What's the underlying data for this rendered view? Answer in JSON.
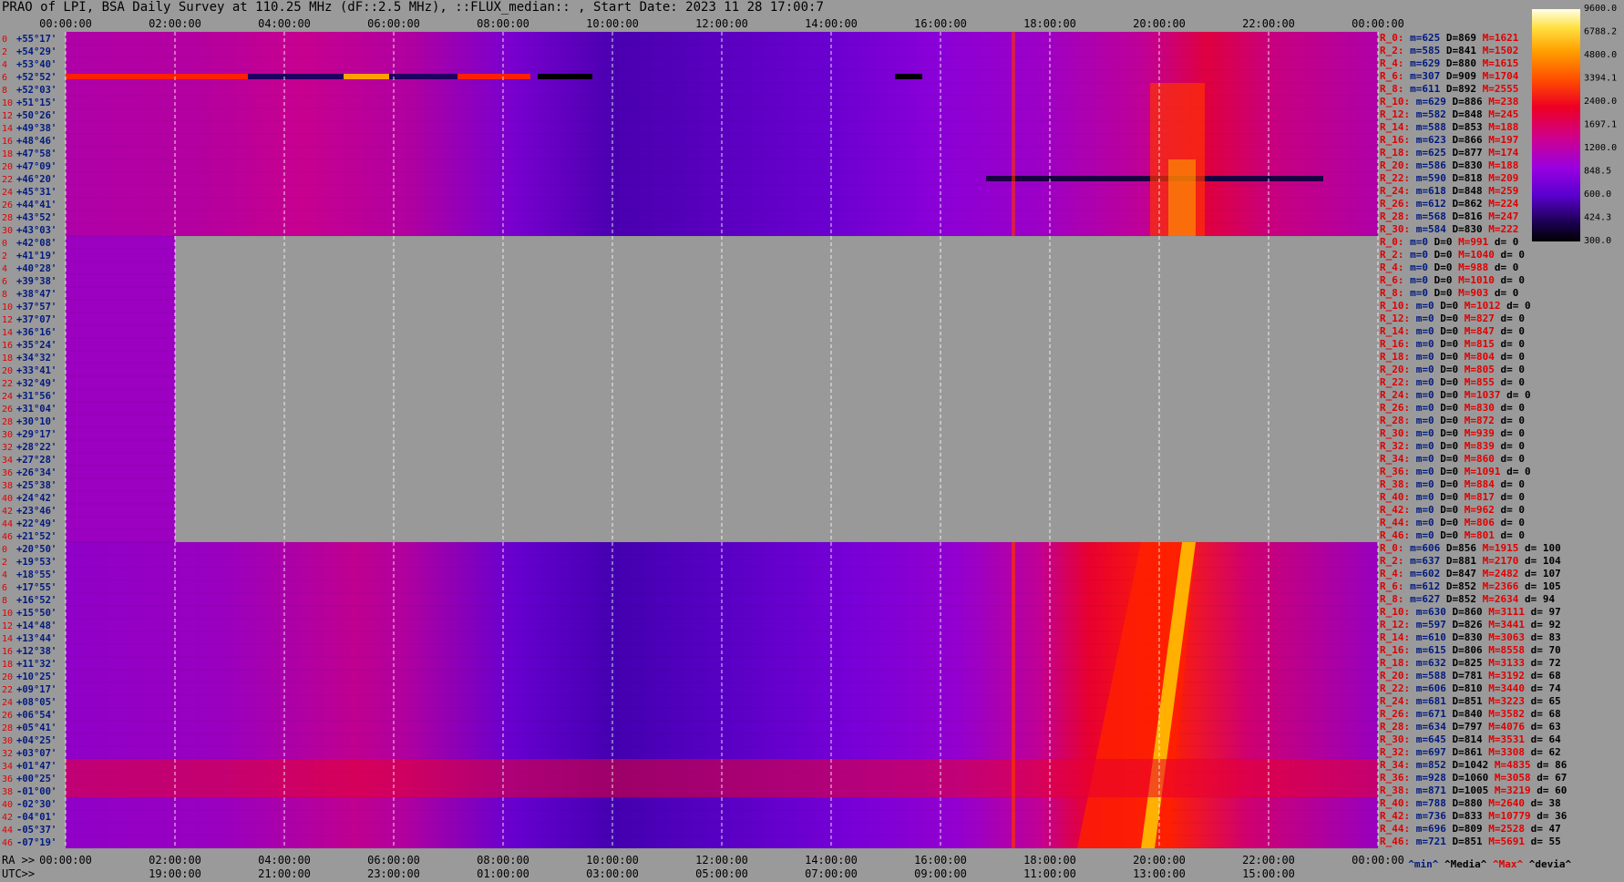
{
  "chart_data": {
    "type": "heatmap",
    "title": "PRAO of LPI, BSA Daily Survey at 110.25 MHz (dF::2.5 MHz), ::FLUX_median:: , Start Date: 2023 11 28 17:00:7",
    "x_top_ticks": [
      "00:00:00",
      "02:00:00",
      "04:00:00",
      "06:00:00",
      "08:00:00",
      "10:00:00",
      "12:00:00",
      "14:00:00",
      "16:00:00",
      "18:00:00",
      "20:00:00",
      "22:00:00",
      "00:00:00"
    ],
    "x_bottom_ticks_ra": [
      "00:00:00",
      "02:00:00",
      "04:00:00",
      "06:00:00",
      "08:00:00",
      "10:00:00",
      "12:00:00",
      "14:00:00",
      "16:00:00",
      "18:00:00",
      "20:00:00",
      "22:00:00",
      "00:00:00"
    ],
    "x_bottom_ticks_utc": [
      "",
      "19:00:00",
      "21:00:00",
      "23:00:00",
      "01:00:00",
      "03:00:00",
      "05:00:00",
      "07:00:00",
      "09:00:00",
      "11:00:00",
      "13:00:00",
      "15:00:00",
      ""
    ],
    "ra_label": "RA >>",
    "utc_label": "UTC>>",
    "colorbar_ticks": [
      "9600.0",
      "6788.2",
      "4800.0",
      "3394.1",
      "2400.0",
      "1697.1",
      "1200.0",
      "848.5",
      "600.0",
      "424.3",
      "300.0"
    ],
    "blocks": [
      {
        "index_labels": [
          "0",
          "2",
          "4",
          "6",
          "8",
          "10",
          "12",
          "14",
          "16",
          "18",
          "20",
          "22",
          "24",
          "26",
          "28",
          "30"
        ],
        "dec_labels": [
          "+55°17'",
          "+54°29'",
          "+53°40'",
          "+52°52'",
          "+52°03'",
          "+51°15'",
          "+50°26'",
          "+49°38'",
          "+48°46'",
          "+47°58'",
          "+47°09'",
          "+46°20'",
          "+45°31'",
          "+44°41'",
          "+43°52'",
          "+43°03'"
        ],
        "stats": [
          [
            "R_0:",
            "m=625",
            "D=869",
            "M=1621",
            ""
          ],
          [
            "R_2:",
            "m=585",
            "D=841",
            "M=1502",
            ""
          ],
          [
            "R_4:",
            "m=629",
            "D=880",
            "M=1615",
            ""
          ],
          [
            "R_6:",
            "m=307",
            "D=909",
            "M=1704",
            ""
          ],
          [
            "R_8:",
            "m=611",
            "D=892",
            "M=2555",
            ""
          ],
          [
            "R_10:",
            "m=629",
            "D=886",
            "M=238",
            ""
          ],
          [
            "R_12:",
            "m=582",
            "D=848",
            "M=245",
            ""
          ],
          [
            "R_14:",
            "m=588",
            "D=853",
            "M=188",
            ""
          ],
          [
            "R_16:",
            "m=623",
            "D=866",
            "M=197",
            ""
          ],
          [
            "R_18:",
            "m=625",
            "D=877",
            "M=174",
            ""
          ],
          [
            "R_20:",
            "m=586",
            "D=830",
            "M=188",
            ""
          ],
          [
            "R_22:",
            "m=590",
            "D=818",
            "M=209",
            ""
          ],
          [
            "R_24:",
            "m=618",
            "D=848",
            "M=259",
            ""
          ],
          [
            "R_26:",
            "m=612",
            "D=862",
            "M=224",
            ""
          ],
          [
            "R_28:",
            "m=568",
            "D=816",
            "M=247",
            ""
          ],
          [
            "R_30:",
            "m=584",
            "D=830",
            "M=222",
            ""
          ]
        ]
      },
      {
        "index_labels": [
          "0",
          "2",
          "4",
          "6",
          "8",
          "10",
          "12",
          "14",
          "16",
          "18",
          "20",
          "22",
          "24",
          "26",
          "28",
          "30",
          "32",
          "34",
          "36",
          "38",
          "40",
          "42",
          "44",
          "46"
        ],
        "dec_labels": [
          "+42°08'",
          "+41°19'",
          "+40°28'",
          "+39°38'",
          "+38°47'",
          "+37°57'",
          "+37°07'",
          "+36°16'",
          "+35°24'",
          "+34°32'",
          "+33°41'",
          "+32°49'",
          "+31°56'",
          "+31°04'",
          "+30°10'",
          "+29°17'",
          "+28°22'",
          "+27°28'",
          "+26°34'",
          "+25°38'",
          "+24°42'",
          "+23°46'",
          "+22°49'",
          "+21°52'"
        ],
        "stats": [
          [
            "R_0:",
            "m=0",
            "D=0",
            "M=991",
            "d= 0"
          ],
          [
            "R_2:",
            "m=0",
            "D=0",
            "M=1040",
            "d= 0"
          ],
          [
            "R_4:",
            "m=0",
            "D=0",
            "M=988",
            "d= 0"
          ],
          [
            "R_6:",
            "m=0",
            "D=0",
            "M=1010",
            "d= 0"
          ],
          [
            "R_8:",
            "m=0",
            "D=0",
            "M=903",
            "d= 0"
          ],
          [
            "R_10:",
            "m=0",
            "D=0",
            "M=1012",
            "d= 0"
          ],
          [
            "R_12:",
            "m=0",
            "D=0",
            "M=827",
            "d= 0"
          ],
          [
            "R_14:",
            "m=0",
            "D=0",
            "M=847",
            "d= 0"
          ],
          [
            "R_16:",
            "m=0",
            "D=0",
            "M=815",
            "d= 0"
          ],
          [
            "R_18:",
            "m=0",
            "D=0",
            "M=804",
            "d= 0"
          ],
          [
            "R_20:",
            "m=0",
            "D=0",
            "M=805",
            "d= 0"
          ],
          [
            "R_22:",
            "m=0",
            "D=0",
            "M=855",
            "d= 0"
          ],
          [
            "R_24:",
            "m=0",
            "D=0",
            "M=1037",
            "d= 0"
          ],
          [
            "R_26:",
            "m=0",
            "D=0",
            "M=830",
            "d= 0"
          ],
          [
            "R_28:",
            "m=0",
            "D=0",
            "M=872",
            "d= 0"
          ],
          [
            "R_30:",
            "m=0",
            "D=0",
            "M=939",
            "d= 0"
          ],
          [
            "R_32:",
            "m=0",
            "D=0",
            "M=839",
            "d= 0"
          ],
          [
            "R_34:",
            "m=0",
            "D=0",
            "M=860",
            "d= 0"
          ],
          [
            "R_36:",
            "m=0",
            "D=0",
            "M=1091",
            "d= 0"
          ],
          [
            "R_38:",
            "m=0",
            "D=0",
            "M=884",
            "d= 0"
          ],
          [
            "R_40:",
            "m=0",
            "D=0",
            "M=817",
            "d= 0"
          ],
          [
            "R_42:",
            "m=0",
            "D=0",
            "M=962",
            "d= 0"
          ],
          [
            "R_44:",
            "m=0",
            "D=0",
            "M=806",
            "d= 0"
          ],
          [
            "R_46:",
            "m=0",
            "D=0",
            "M=801",
            "d= 0"
          ]
        ]
      },
      {
        "index_labels": [
          "0",
          "2",
          "4",
          "6",
          "8",
          "10",
          "12",
          "14",
          "16",
          "18",
          "20",
          "22",
          "24",
          "26",
          "28",
          "30",
          "32",
          "34",
          "36",
          "38",
          "40",
          "42",
          "44",
          "46"
        ],
        "dec_labels": [
          "+20°50'",
          "+19°53'",
          "+18°55'",
          "+17°55'",
          "+16°52'",
          "+15°50'",
          "+14°48'",
          "+13°44'",
          "+12°38'",
          "+11°32'",
          "+10°25'",
          "+09°17'",
          "+08°05'",
          "+06°54'",
          "+05°41'",
          "+04°25'",
          "+03°07'",
          "+01°47'",
          "+00°25'",
          "-01°00'",
          "-02°30'",
          "-04°01'",
          "-05°37'",
          "-07°19'"
        ],
        "stats": [
          [
            "R_0:",
            "m=606",
            "D=856",
            "M=1915",
            "d= 100"
          ],
          [
            "R_2:",
            "m=637",
            "D=881",
            "M=2170",
            "d= 104"
          ],
          [
            "R_4:",
            "m=602",
            "D=847",
            "M=2482",
            "d= 107"
          ],
          [
            "R_6:",
            "m=612",
            "D=852",
            "M=2366",
            "d= 105"
          ],
          [
            "R_8:",
            "m=627",
            "D=852",
            "M=2634",
            "d= 94"
          ],
          [
            "R_10:",
            "m=630",
            "D=860",
            "M=3111",
            "d= 97"
          ],
          [
            "R_12:",
            "m=597",
            "D=826",
            "M=3441",
            "d= 92"
          ],
          [
            "R_14:",
            "m=610",
            "D=830",
            "M=3063",
            "d= 83"
          ],
          [
            "R_16:",
            "m=615",
            "D=806",
            "M=8558",
            "d= 70"
          ],
          [
            "R_18:",
            "m=632",
            "D=825",
            "M=3133",
            "d= 72"
          ],
          [
            "R_20:",
            "m=588",
            "D=781",
            "M=3192",
            "d= 68"
          ],
          [
            "R_22:",
            "m=606",
            "D=810",
            "M=3440",
            "d= 74"
          ],
          [
            "R_24:",
            "m=681",
            "D=851",
            "M=3223",
            "d= 65"
          ],
          [
            "R_26:",
            "m=671",
            "D=840",
            "M=3582",
            "d= 68"
          ],
          [
            "R_28:",
            "m=634",
            "D=797",
            "M=4076",
            "d= 63"
          ],
          [
            "R_30:",
            "m=645",
            "D=814",
            "M=3531",
            "d= 64"
          ],
          [
            "R_32:",
            "m=697",
            "D=861",
            "M=3308",
            "d= 62"
          ],
          [
            "R_34:",
            "m=852",
            "D=1042",
            "M=4835",
            "d= 86"
          ],
          [
            "R_36:",
            "m=928",
            "D=1060",
            "M=3058",
            "d= 67"
          ],
          [
            "R_38:",
            "m=871",
            "D=1005",
            "M=3219",
            "d= 60"
          ],
          [
            "R_40:",
            "m=788",
            "D=880",
            "M=2640",
            "d= 38"
          ],
          [
            "R_42:",
            "m=736",
            "D=833",
            "M=10779",
            "d= 36"
          ],
          [
            "R_44:",
            "m=696",
            "D=809",
            "M=2528",
            "d= 47"
          ],
          [
            "R_46:",
            "m=721",
            "D=851",
            "M=5691",
            "d= 55"
          ]
        ]
      }
    ],
    "footer_legend": [
      "^min^",
      "^Media^",
      "^Max^",
      "^devia^"
    ],
    "colors": {
      "background": "#9a9a9a",
      "index_label": "#e00000",
      "dec_label": "#001a80",
      "grid": "#ffffff",
      "no_data": "#999999"
    }
  }
}
